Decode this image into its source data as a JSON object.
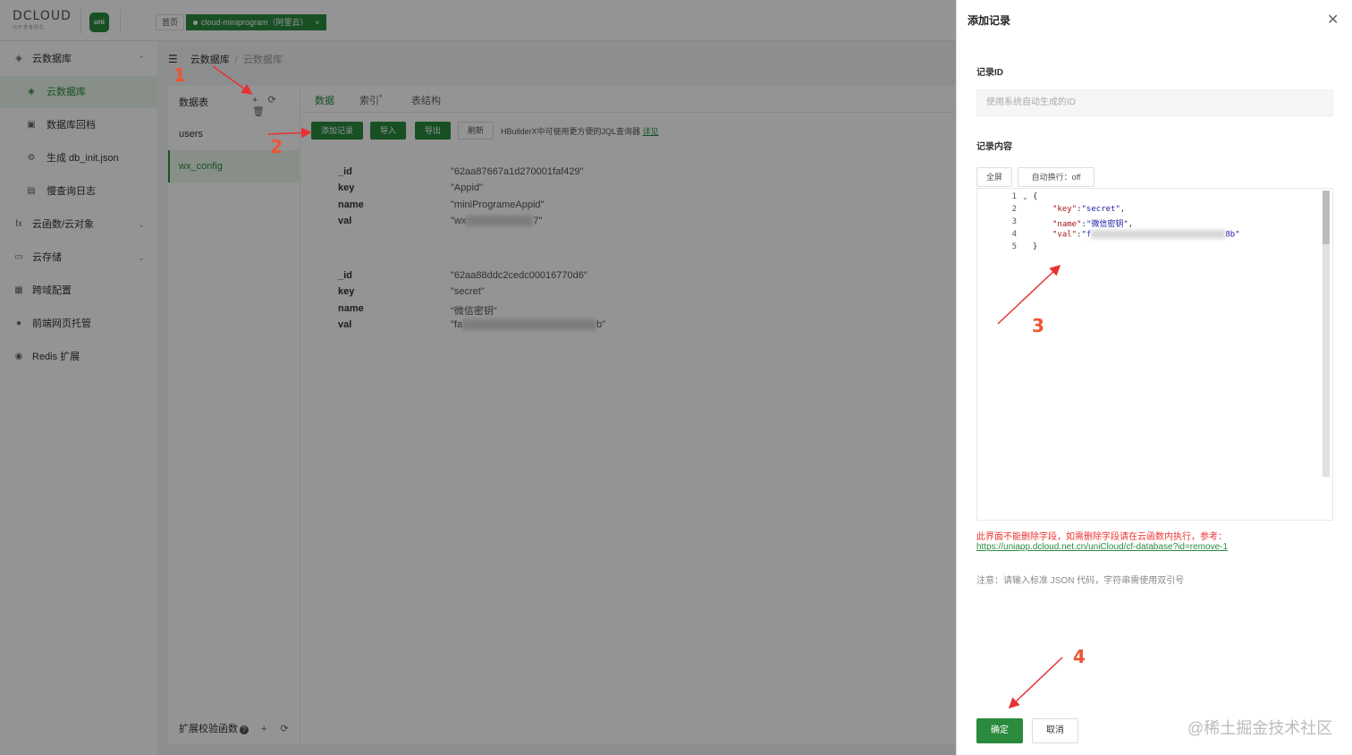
{
  "topbar": {
    "logo_text": "DCLOUD",
    "logo_sub": "为开发者而生",
    "uni_icon_text": "uni",
    "home_tab": "首页",
    "active_tab": "cloud-miniprogram（阿里云）",
    "active_tab_close": "×"
  },
  "sidebar": {
    "items": [
      {
        "icon": "cloud-db-icon",
        "glyph": "◈",
        "label": "云数据库",
        "arrow": "⌃"
      },
      {
        "icon": "db-icon",
        "glyph": "◈",
        "label": "云数据库"
      },
      {
        "icon": "archive-icon",
        "glyph": "▣",
        "label": "数据库回档"
      },
      {
        "icon": "gear-icon",
        "glyph": "⚙",
        "label": "生成 db_init.json"
      },
      {
        "icon": "log-icon",
        "glyph": "▤",
        "label": "慢查询日志"
      },
      {
        "icon": "function-icon",
        "glyph": "fx",
        "label": "云函数/云对象",
        "arrow": "⌄"
      },
      {
        "icon": "storage-icon",
        "glyph": "▭",
        "label": "云存储",
        "arrow": "⌄"
      },
      {
        "icon": "cross-domain-icon",
        "glyph": "▦",
        "label": "跨域配置"
      },
      {
        "icon": "hosting-icon",
        "glyph": "●",
        "label": "前端网页托管"
      },
      {
        "icon": "redis-icon",
        "glyph": "◉",
        "label": "Redis 扩展"
      }
    ]
  },
  "breadcrumb": {
    "menu_glyph": "☰",
    "level1": "云数据库",
    "separator": "/",
    "level2": "云数据库"
  },
  "tables": {
    "header": "数据表",
    "header_icons": "+ ⟳ 🗑",
    "items": [
      "users",
      "wx_config"
    ],
    "ext_fn_label": "扩展校验函数",
    "ext_fn_q": "?",
    "ext_fn_ops": "+ ⟳"
  },
  "data_tabs": [
    {
      "label": "数据",
      "active": true
    },
    {
      "label": "索引",
      "star": "*"
    },
    {
      "label": "表结构"
    }
  ],
  "toolbar": {
    "add_record": "添加记录",
    "import": "导入",
    "export": "导出",
    "refresh": "刷新",
    "tip": "HBuilderX中可使用更方便的JQL查询器",
    "tip_link": "详见"
  },
  "records": [
    {
      "rows": [
        {
          "key": "_id",
          "value": "\"62aa87667a1d270001faf429\""
        },
        {
          "key": "key",
          "value": "\"Appid\""
        },
        {
          "key": "name",
          "value": "\"miniProgrameAppid\""
        },
        {
          "key": "val",
          "value_prefix": "\"wx",
          "value_suffix": "7\""
        }
      ]
    },
    {
      "rows": [
        {
          "key": "_id",
          "value": "\"62aa88ddc2cedc00016770d6\""
        },
        {
          "key": "key",
          "value": "\"secret\""
        },
        {
          "key": "name",
          "value": "\"微信密钥\""
        },
        {
          "key": "val",
          "value_prefix": "\"fa",
          "value_suffix": "b\""
        }
      ]
    }
  ],
  "drawer": {
    "title": "添加记录",
    "close_glyph": "✕",
    "record_id_label": "记录ID",
    "record_id_placeholder": "使用系统自动生成的ID",
    "content_label": "记录内容",
    "fullscreen_btn": "全屏",
    "wrap_btn": "自动换行：off",
    "editor_lines": [
      "1",
      "2",
      "3",
      "4",
      "5"
    ],
    "code": {
      "open": "{",
      "l2_key": "\"key\"",
      "l2_val": "\"secret\"",
      "l3_key": "\"name\"",
      "l3_val": "\"微信密钥\"",
      "l4_key": "\"val\"",
      "l4_val_prefix": "\"f",
      "l4_val_suffix": "8b\"",
      "close": "}",
      "colon": ":",
      "comma": ","
    },
    "warning": "此界面不能删除字段，如需删除字段请在云函数内执行，参考：",
    "warning_link": "https://uniapp.dcloud.net.cn/uniCloud/cf-database?id=remove-1",
    "note": "注意：请输入标准 JSON 代码，字符串需使用双引号",
    "ok_button": "确定",
    "cancel_button": "取消"
  },
  "watermark": "@稀土掘金技术社区",
  "annotations": [
    "1",
    "2",
    "3",
    "4"
  ],
  "colors": {
    "brand_green": "#2a8a3e",
    "annotation_red": "#e53333",
    "warning_red": "#ee3333"
  }
}
